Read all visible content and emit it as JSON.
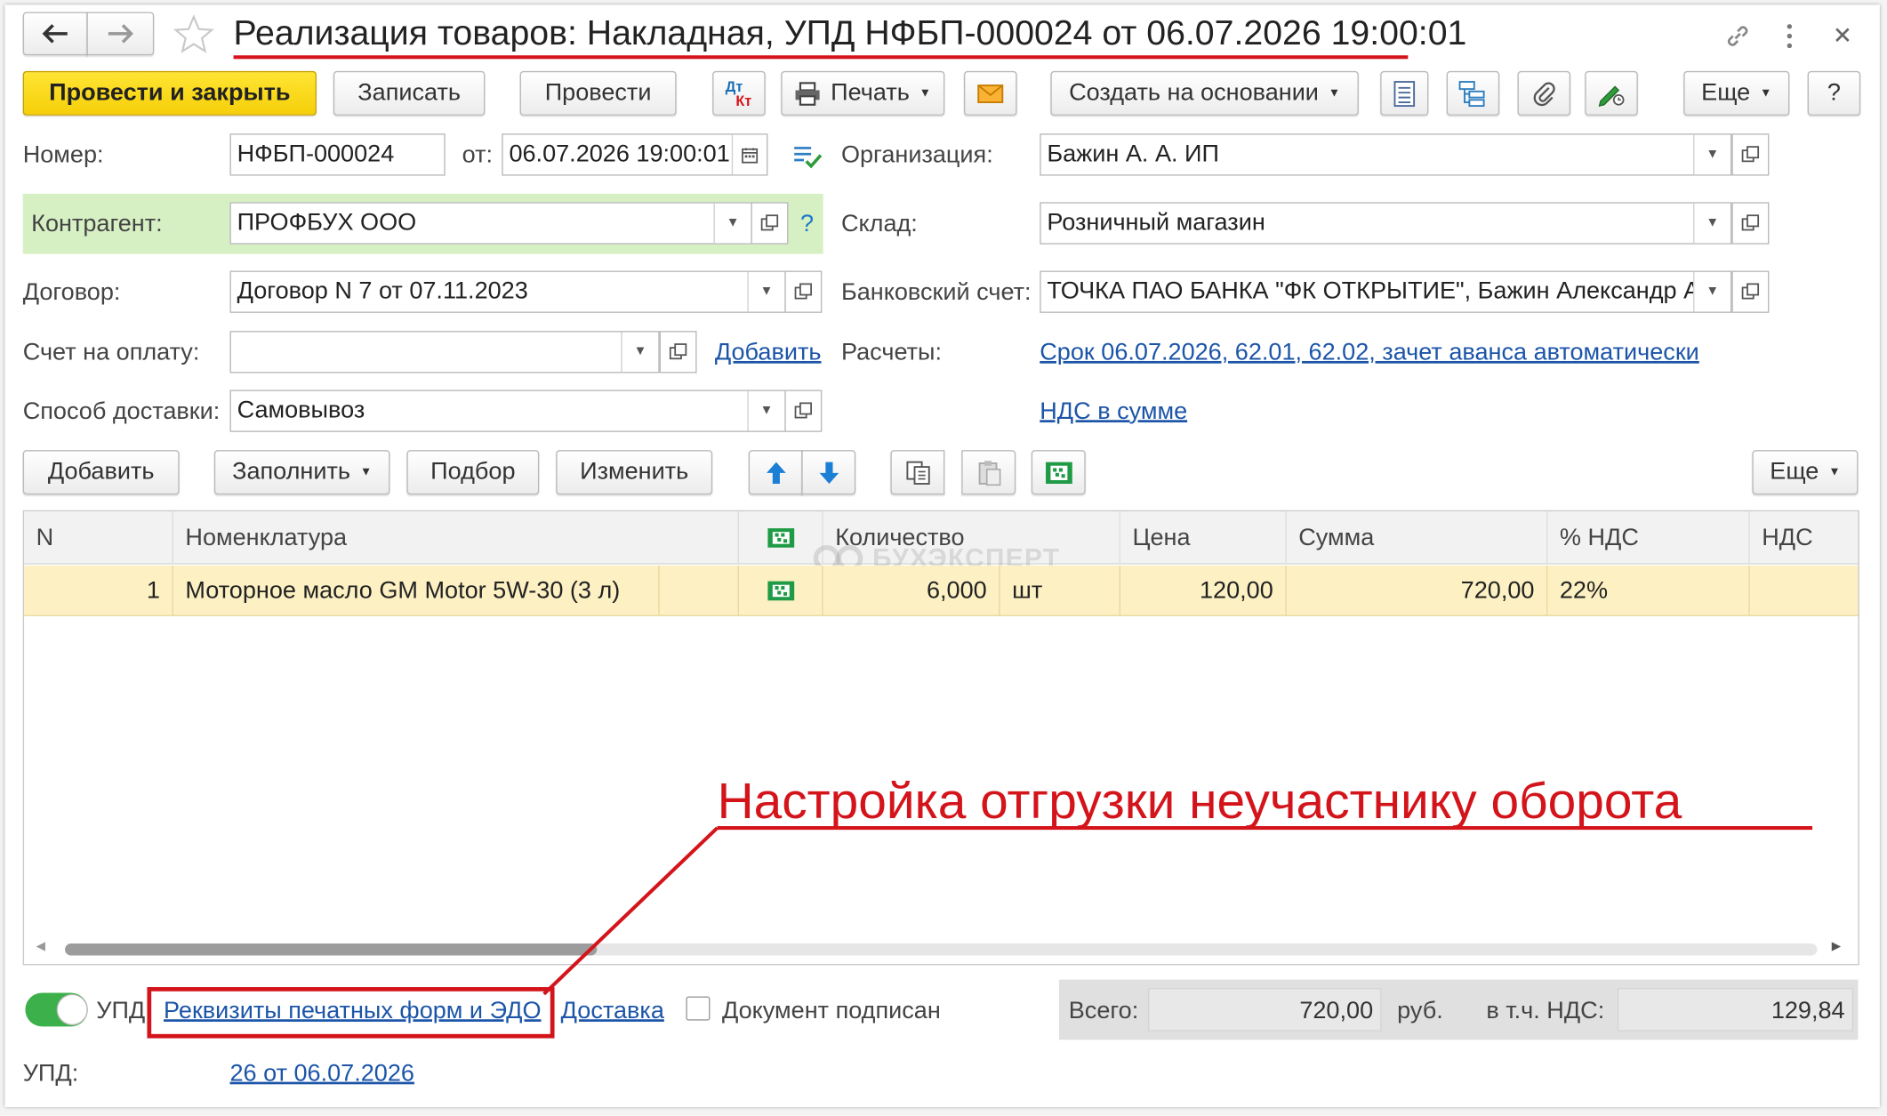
{
  "window": {
    "title": "Реализация товаров: Накладная, УПД НФБП-000024 от 06.07.2026 19:00:01"
  },
  "toolbar": {
    "post_close": "Провести и закрыть",
    "save": "Записать",
    "post": "Провести",
    "dtkt_top": "Дт",
    "dtkt_bottom": "Кт",
    "print": "Печать",
    "create_based": "Создать на основании",
    "more": "Еще",
    "help": "?"
  },
  "form": {
    "number_label": "Номер:",
    "number_value": "НФБП-000024",
    "date_label": "от:",
    "date_value": "06.07.2026 19:00:01",
    "org_label": "Организация:",
    "org_value": "Бажин А. А. ИП",
    "counterparty_label": "Контрагент:",
    "counterparty_value": "ПРОФБУХ ООО",
    "counterparty_help": "?",
    "warehouse_label": "Склад:",
    "warehouse_value": "Розничный магазин",
    "contract_label": "Договор:",
    "contract_value": "Договор N 7 от 07.11.2023",
    "bank_label": "Банковский счет:",
    "bank_value": "ТОЧКА ПАО БАНКА \"ФК ОТКРЫТИЕ\", Бажин Александр А",
    "invoice_label": "Счет на оплату:",
    "invoice_value": "",
    "invoice_add": "Добавить",
    "settlements_label": "Расчеты:",
    "settlements_link": "Срок 06.07.2026, 62.01, 62.02, зачет аванса автоматически",
    "delivery_label": "Способ доставки:",
    "delivery_value": "Самовывоз",
    "vat_link": "НДС в сумме"
  },
  "table_toolbar": {
    "add": "Добавить",
    "fill": "Заполнить",
    "pick": "Подбор",
    "change": "Изменить",
    "more": "Еще"
  },
  "table": {
    "headers": [
      "N",
      "Номенклатура",
      "",
      "Количество",
      "Цена",
      "Сумма",
      "% НДС",
      "НДС"
    ],
    "rows": [
      {
        "n": "1",
        "name": "Моторное масло GM Motor 5W-30 (3 л)",
        "qty": "6,000",
        "unit": "шт",
        "price": "120,00",
        "sum": "720,00",
        "vat_rate": "22%",
        "vat": ""
      }
    ],
    "watermark": "БУХЭКСПЕРТ"
  },
  "footer": {
    "upd_toggle_label": "УПД",
    "print_forms_link": "Реквизиты печатных форм и ЭДО",
    "delivery_link": "Доставка",
    "signed_label": "Документ подписан",
    "total_label": "Всего:",
    "total_value": "720,00",
    "currency": "руб.",
    "vat_incl_label": "в т.ч. НДС:",
    "vat_value": "129,84",
    "upd_label": "УПД:",
    "upd_link": "26 от 06.07.2026"
  },
  "annotation": {
    "text": "Настройка отгрузки неучастнику оборота",
    "color": "#d4141b"
  },
  "colors": {
    "accent_yellow": "#f5cf0a",
    "highlight_green": "#d6f0c4",
    "selected_row": "#fdf1c3",
    "link_blue": "#1c55a8",
    "toggle_green": "#3cb04a"
  }
}
